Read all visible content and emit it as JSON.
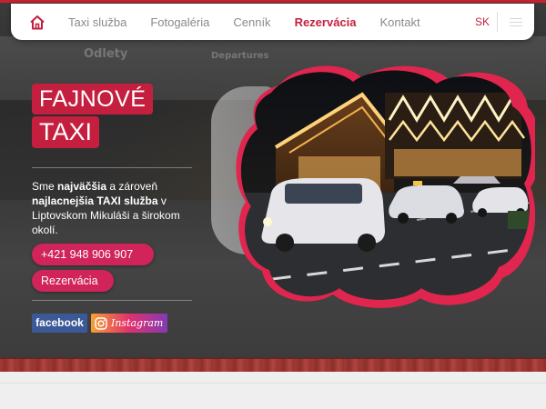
{
  "nav": {
    "items": [
      "Taxi služba",
      "Fotogaléria",
      "Cenník",
      "Rezervácia",
      "Kontakt"
    ],
    "active": "Rezervácia",
    "lang": "SK"
  },
  "hero": {
    "brand_line1": "FAJNOVÉ",
    "brand_line2": "TAXI",
    "intro_parts": [
      "Sme ",
      "najväčšia",
      " a zároveň ",
      "najlacnejšia TAXI služba",
      " v Liptovskom Mikuláši a širokom okolí."
    ],
    "phone_button": "+421 948 906 907",
    "reservation_button": "Rezervácia",
    "facebook_label": "facebook",
    "instagram_label": "Instagram"
  },
  "background_signs": [
    "Odlety",
    "Departures"
  ],
  "colors": {
    "brand": "#c51f3f",
    "button": "#d0245a",
    "blob": "#e0264f",
    "facebook": "#3b5998"
  },
  "icons": [
    "home-icon",
    "menu-icon",
    "instagram-icon"
  ]
}
